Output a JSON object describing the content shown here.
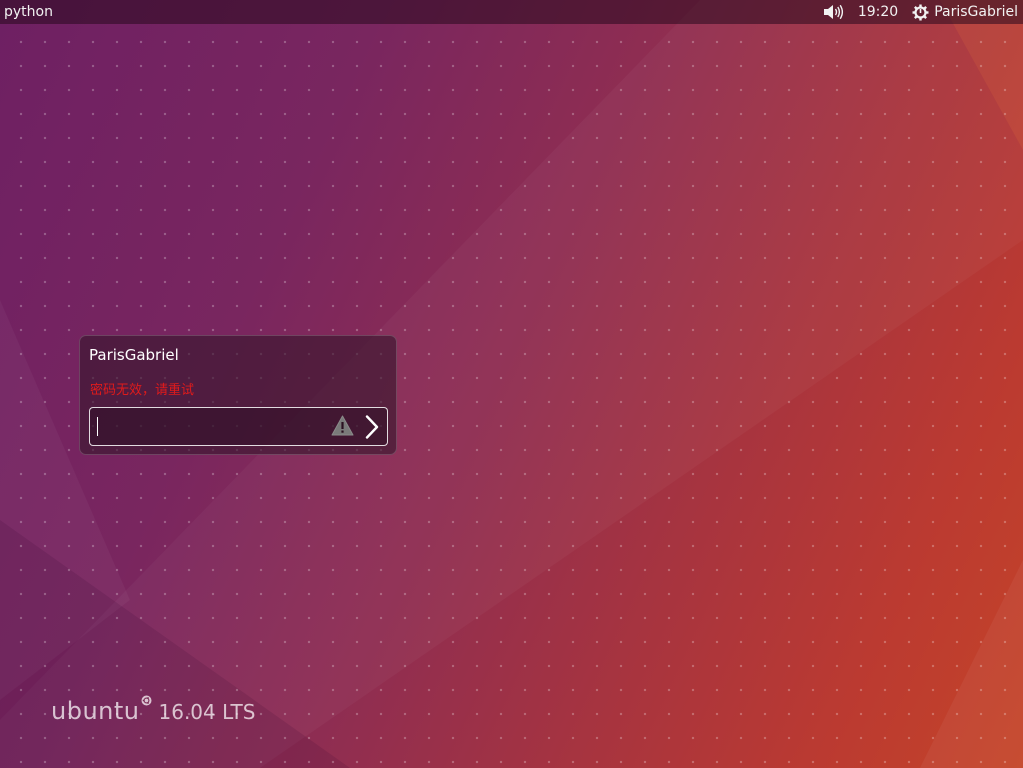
{
  "top_panel": {
    "app_label": "python",
    "clock": "19:20",
    "session_user": "ParisGabriel",
    "icons": {
      "volume": "volume-icon",
      "power": "power-gear-icon"
    }
  },
  "login": {
    "username": "ParisGabriel",
    "error_message": "密码无效，请重试",
    "password_value": "",
    "icons": {
      "warning": "warning-icon",
      "submit": "chevron-right-icon"
    }
  },
  "branding": {
    "word": "ubuntu",
    "logo": "circle-of-friends-icon",
    "version": "16.04 LTS"
  },
  "colors": {
    "error": "#e01b1b",
    "panel": "#3a0f28",
    "background_left": "#6e2063",
    "background_right": "#c44428"
  }
}
